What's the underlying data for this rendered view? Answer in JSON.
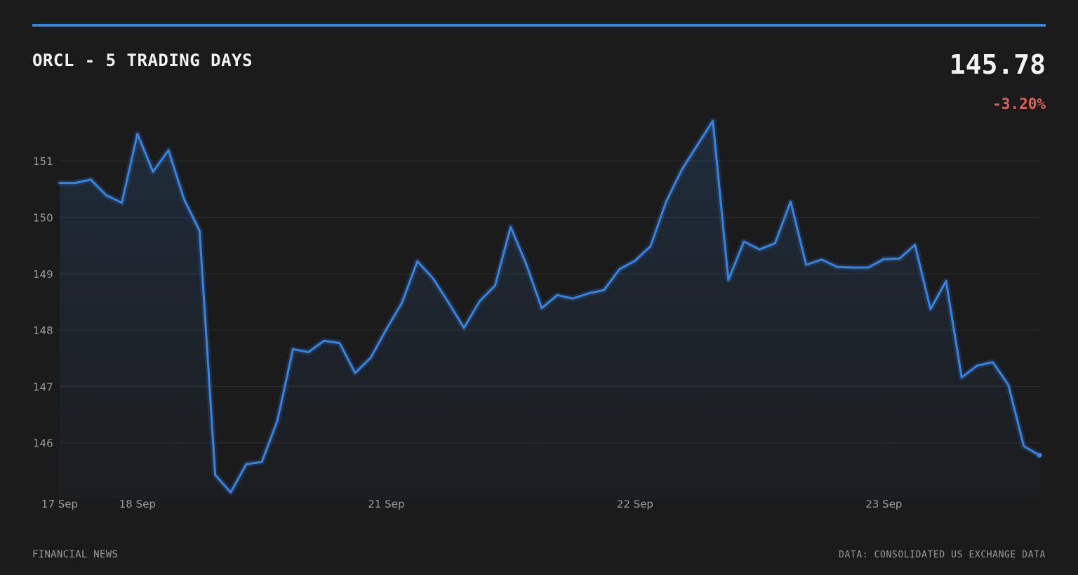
{
  "header": {
    "title": "ORCL - 5 TRADING DAYS",
    "price": "145.78",
    "change": "-3.20%"
  },
  "colors": {
    "background": "#1b1b1b",
    "accent": "#3584e4",
    "negative": "#e0605a",
    "grid": "#2e2e2e",
    "axis_text": "#9a9a9a"
  },
  "chart_data": {
    "type": "area",
    "y_ticks": [
      146,
      147,
      148,
      149,
      150,
      151
    ],
    "ylim": [
      145.1,
      151.8
    ],
    "grid": true,
    "x_tick_labels": [
      {
        "label": "17 Sep",
        "index": 0
      },
      {
        "label": "18 Sep",
        "index": 5
      },
      {
        "label": "21 Sep",
        "index": 21
      },
      {
        "label": "22 Sep",
        "index": 37
      },
      {
        "label": "23 Sep",
        "index": 53
      }
    ],
    "series": [
      {
        "values": [
          150.61,
          150.61,
          150.67,
          150.39,
          150.26,
          151.48,
          150.81,
          151.19,
          150.32,
          149.76,
          145.43,
          145.12,
          145.62,
          145.66,
          146.39,
          147.66,
          147.61,
          147.81,
          147.77,
          147.24,
          147.51,
          148.01,
          148.48,
          149.22,
          148.92,
          148.49,
          148.04,
          148.51,
          148.79,
          149.83,
          149.17,
          148.39,
          148.62,
          148.56,
          148.65,
          148.71,
          149.08,
          149.23,
          149.49,
          150.28,
          150.84,
          151.28,
          151.71,
          148.89,
          149.57,
          149.43,
          149.54,
          150.28,
          149.16,
          149.25,
          149.12,
          149.11,
          149.11,
          149.26,
          149.27,
          149.51,
          148.37,
          148.87,
          147.16,
          147.37,
          147.43,
          147.03,
          145.94,
          145.78
        ]
      }
    ]
  },
  "footer": {
    "left": "FINANCIAL NEWS",
    "right": "DATA: CONSOLIDATED US EXCHANGE DATA"
  }
}
